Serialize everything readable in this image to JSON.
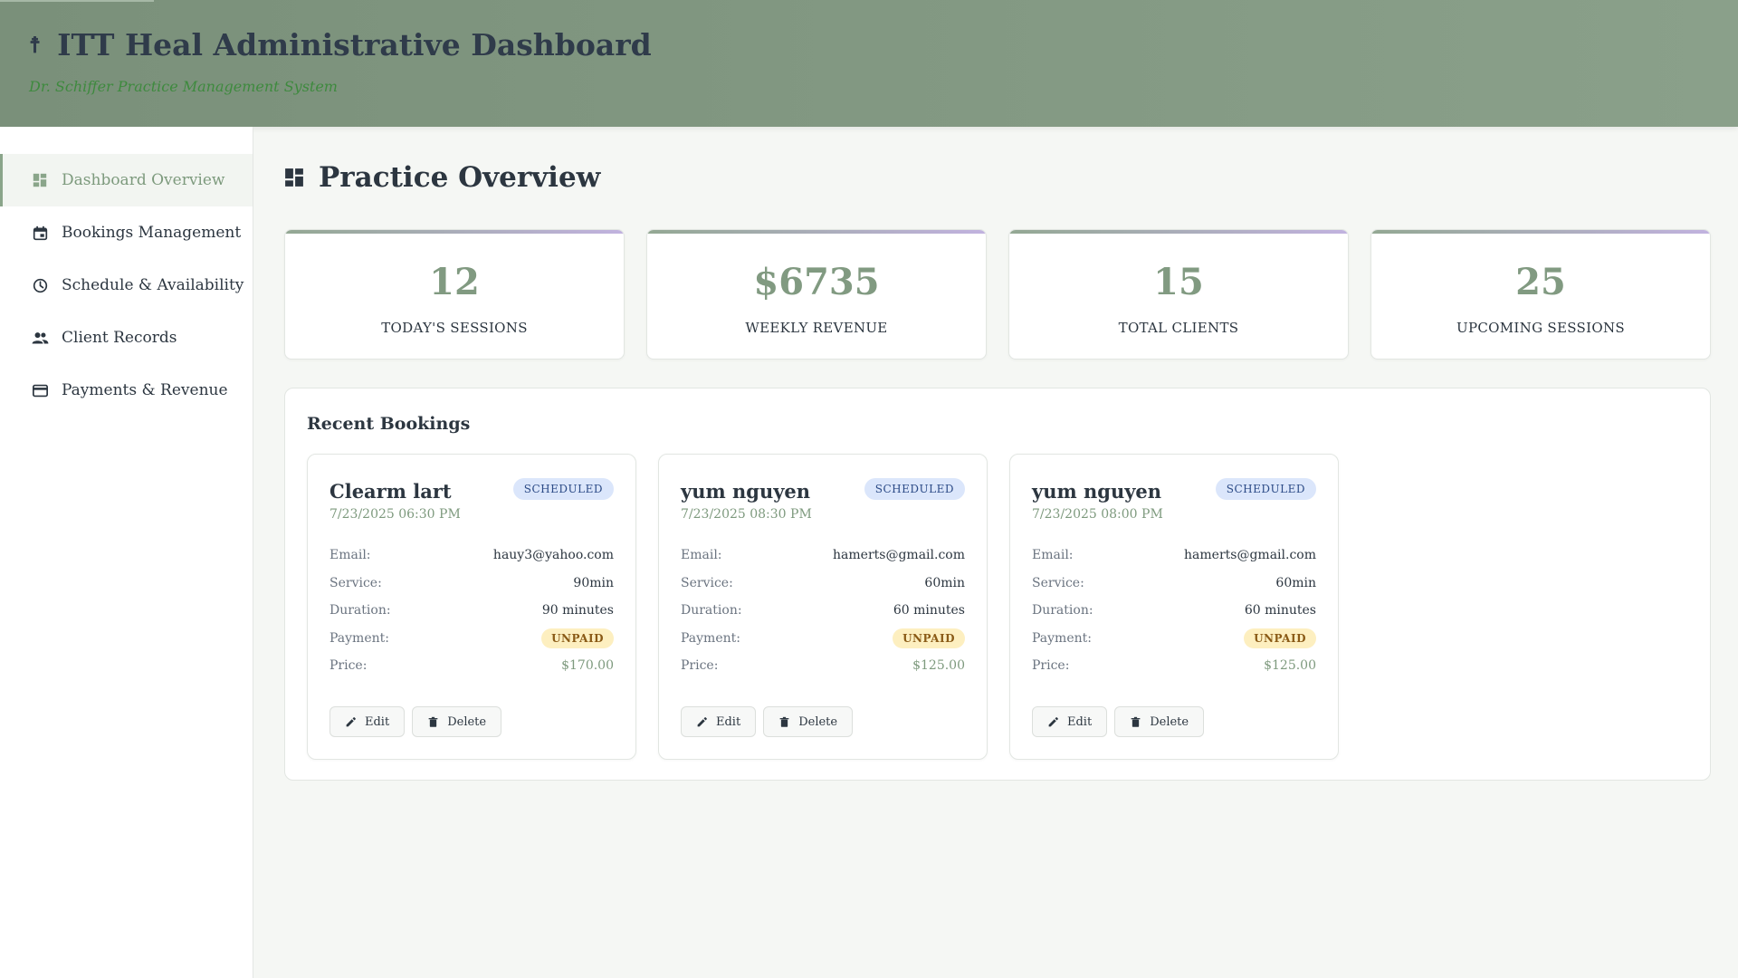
{
  "header": {
    "title": "ITT Heal Administrative Dashboard",
    "subtitle": "Dr. Schiffer Practice Management System",
    "cross_glyph": "☨"
  },
  "sidebar": {
    "items": [
      {
        "label": "Dashboard Overview",
        "icon": "dashboard-icon",
        "active": true
      },
      {
        "label": "Bookings Management",
        "icon": "calendar-icon",
        "active": false
      },
      {
        "label": "Schedule & Availability",
        "icon": "clock-icon",
        "active": false
      },
      {
        "label": "Client Records",
        "icon": "people-icon",
        "active": false
      },
      {
        "label": "Payments & Revenue",
        "icon": "credit-card-icon",
        "active": false
      }
    ]
  },
  "main": {
    "title": "Practice Overview",
    "stats": [
      {
        "value": "12",
        "label": "TODAY'S SESSIONS"
      },
      {
        "value": "$6735",
        "label": "WEEKLY REVENUE"
      },
      {
        "value": "15",
        "label": "TOTAL CLIENTS"
      },
      {
        "value": "25",
        "label": "UPCOMING SESSIONS"
      }
    ],
    "recent_bookings": {
      "title": "Recent Bookings",
      "field_labels": {
        "email": "Email:",
        "service": "Service:",
        "duration": "Duration:",
        "payment": "Payment:",
        "price": "Price:"
      },
      "edit_label": "Edit",
      "delete_label": "Delete",
      "items": [
        {
          "name": "Clearm lart",
          "datetime": "7/23/2025 06:30 PM",
          "status": "SCHEDULED",
          "email": "hauy3@yahoo.com",
          "service": "90min",
          "duration": "90 minutes",
          "payment": "UNPAID",
          "price": "$170.00"
        },
        {
          "name": "yum nguyen",
          "datetime": "7/23/2025 08:30 PM",
          "status": "SCHEDULED",
          "email": "hamerts@gmail.com",
          "service": "60min",
          "duration": "60 minutes",
          "payment": "UNPAID",
          "price": "$125.00"
        },
        {
          "name": "yum nguyen",
          "datetime": "7/23/2025 08:00 PM",
          "status": "SCHEDULED",
          "email": "hamerts@gmail.com",
          "service": "60min",
          "duration": "60 minutes",
          "payment": "UNPAID",
          "price": "$125.00"
        }
      ]
    }
  },
  "colors": {
    "header_bg": "#869c86",
    "accent_green": "#819a81",
    "scheduled_badge_bg": "#dbe6fb",
    "unpaid_badge_bg": "#fdefc0"
  }
}
